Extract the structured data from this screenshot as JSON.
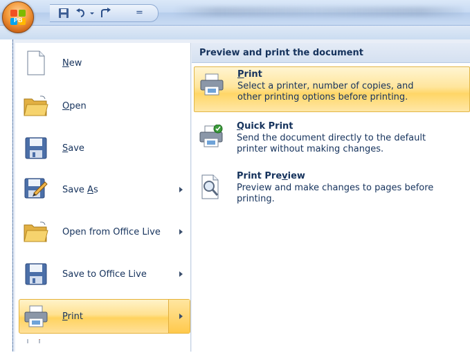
{
  "titlebar": {
    "qat_separator": "="
  },
  "left_menu": {
    "items": [
      {
        "label": "New",
        "mnemonic_index": 0,
        "icon": "new-document-icon",
        "has_submenu": false
      },
      {
        "label": "Open",
        "mnemonic_index": 0,
        "icon": "open-folder-icon",
        "has_submenu": false
      },
      {
        "label": "Save",
        "mnemonic_index": 0,
        "icon": "save-disk-icon",
        "has_submenu": false
      },
      {
        "label": "Save As",
        "mnemonic_index": 5,
        "icon": "save-as-icon",
        "has_submenu": true
      },
      {
        "label": "Open from Office Live",
        "mnemonic_index": -1,
        "icon": "open-folder-icon",
        "has_submenu": true
      },
      {
        "label": "Save to Office Live",
        "mnemonic_index": -1,
        "icon": "save-disk-icon",
        "has_submenu": true
      },
      {
        "label": "Print",
        "mnemonic_index": 0,
        "icon": "printer-icon",
        "has_submenu": true,
        "selected": true
      }
    ]
  },
  "right_pane": {
    "header": "Preview and print the document",
    "items": [
      {
        "title": "Print",
        "mnemonic_index": 0,
        "desc_line1": "Select a printer, number of copies, and",
        "desc_line2": "other printing options before printing.",
        "icon": "printer-icon",
        "selected": true
      },
      {
        "title": "Quick Print",
        "mnemonic_index": 0,
        "desc_line1": "Send the document directly to the default",
        "desc_line2": "printer without making changes.",
        "icon": "quick-print-icon",
        "selected": false
      },
      {
        "title": "Print Preview",
        "mnemonic_index": 8,
        "desc_line1": "Preview and make changes to pages before",
        "desc_line2": "printing.",
        "icon": "print-preview-icon",
        "selected": false
      }
    ]
  },
  "colors": {
    "selected_gradient_top": "#fff3c9",
    "selected_gradient_mid": "#ffd35f",
    "text": "#15325c"
  }
}
